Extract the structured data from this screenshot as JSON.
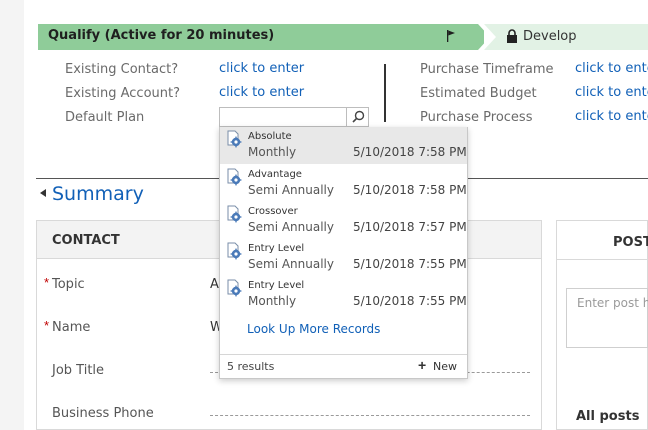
{
  "process": {
    "active_stage": "Qualify (Active for 20 minutes)",
    "next_stage": "Develop",
    "active_color": "#8fcc99",
    "next_color": "#e2f2e5"
  },
  "fields_left": [
    {
      "label": "Existing Contact?",
      "value": "click to enter"
    },
    {
      "label": "Existing Account?",
      "value": "click to enter"
    },
    {
      "label": "Default Plan",
      "value": ""
    }
  ],
  "fields_right": [
    {
      "label": "Purchase Timeframe",
      "value": "click to ente"
    },
    {
      "label": "Estimated Budget",
      "value": "click to ente"
    },
    {
      "label": "Purchase Process",
      "value": "click to ente"
    }
  ],
  "summary": {
    "title": "Summary"
  },
  "contact": {
    "title": "CONTACT",
    "fields": [
      {
        "label": "Topic",
        "value": "A",
        "required": true
      },
      {
        "label": "Name",
        "value": "W",
        "required": true
      },
      {
        "label": "Job Title",
        "value": ""
      },
      {
        "label": "Business Phone",
        "value": ""
      }
    ]
  },
  "posts": {
    "tab": "POST",
    "placeholder": "Enter post h",
    "all_posts": "All posts"
  },
  "lookup": {
    "items": [
      {
        "name1": "Absolute",
        "name2": "Monthly",
        "date": "5/10/2018 7:58 PM"
      },
      {
        "name1": "Advantage",
        "name2": "Semi Annually",
        "date": "5/10/2018 7:58 PM"
      },
      {
        "name1": "Crossover",
        "name2": "Semi Annually",
        "date": "5/10/2018 7:57 PM"
      },
      {
        "name1": "Entry Level",
        "name2": "Semi Annually",
        "date": "5/10/2018 7:55 PM"
      },
      {
        "name1": "Entry Level",
        "name2": "Monthly",
        "date": "5/10/2018 7:55 PM"
      }
    ],
    "more_label": "Look Up More Records",
    "result_count": "5 results",
    "new_label": "New"
  },
  "icons": {
    "stage_flag": "flag-icon",
    "stage_lock": "lock-icon",
    "lookup_search": "search-icon",
    "record": "product-gear-icon",
    "summary_toggle": "caret-icon",
    "new": "plus-icon"
  }
}
